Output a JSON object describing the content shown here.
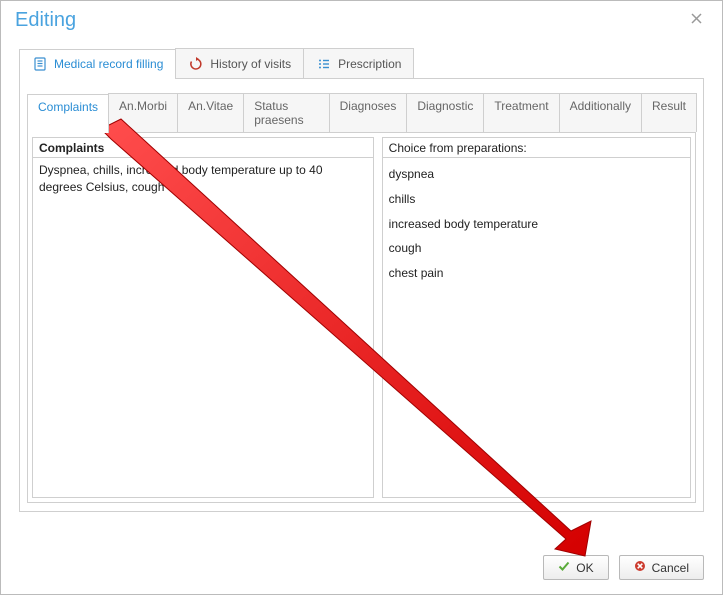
{
  "window": {
    "title": "Editing"
  },
  "outerTabs": [
    {
      "label": "Medical record filling",
      "icon": "document-icon",
      "active": true
    },
    {
      "label": "History of visits",
      "icon": "refresh-icon",
      "active": false
    },
    {
      "label": "Prescription",
      "icon": "list-icon",
      "active": false
    }
  ],
  "innerTabs": [
    {
      "label": "Complaints",
      "active": true
    },
    {
      "label": "An.Morbi",
      "active": false
    },
    {
      "label": "An.Vitae",
      "active": false
    },
    {
      "label": "Status praesens",
      "active": false
    },
    {
      "label": "Diagnoses",
      "active": false
    },
    {
      "label": "Diagnostic",
      "active": false
    },
    {
      "label": "Treatment",
      "active": false
    },
    {
      "label": "Additionally",
      "active": false
    },
    {
      "label": "Result",
      "active": false
    }
  ],
  "leftPanel": {
    "heading": "Complaints",
    "text": "Dyspnea, chills, increased body temperature up to 40 degrees Celsius, cough"
  },
  "rightPanel": {
    "heading": "Choice from preparations:",
    "items": [
      "dyspnea",
      "chills",
      "increased body temperature",
      "cough",
      "chest pain"
    ]
  },
  "buttons": {
    "ok": "OK",
    "cancel": "Cancel"
  }
}
